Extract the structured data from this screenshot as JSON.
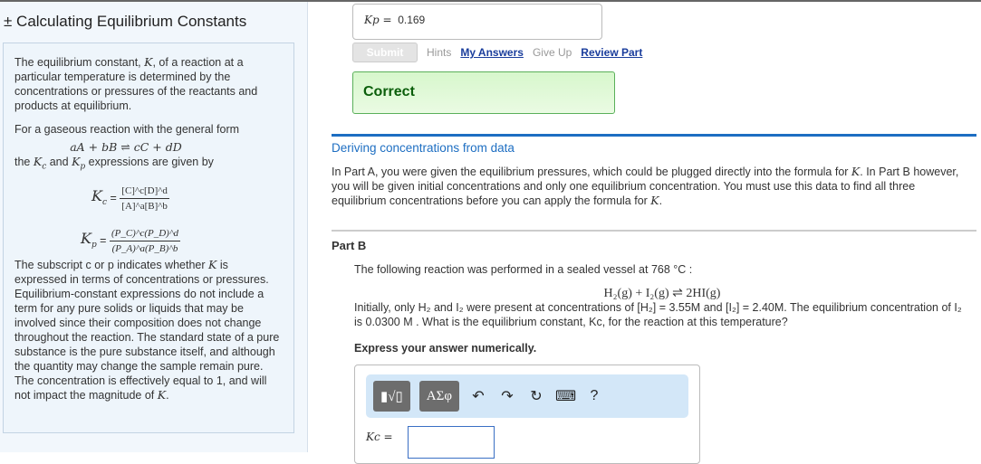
{
  "sidebar": {
    "title": "± Calculating Equilibrium Constants",
    "p1a": "The equilibrium constant, ",
    "K": "K",
    "p1b": ", of a reaction at a particular temperature is determined by the concentrations or pressures of the reactants and products at equilibrium.",
    "p2": "For a gaseous reaction with the general form",
    "general_reaction": "aA + bB ⇌ cC + dD",
    "p3a": "the ",
    "Kc": "Kc",
    "p3b": " and ",
    "Kp": "Kp",
    "p3c": " expressions are given by",
    "kc_num": "[C]^c[D]^d",
    "kc_den": "[A]^a[B]^b",
    "kp_num": "(P_C)^c(P_D)^d",
    "kp_den": "(P_A)^a(P_B)^b",
    "p4a": "The subscript c or p indicates whether ",
    "p4b": " is expressed in terms of concentrations or pressures. Equilibrium-constant expressions do not include a term for any pure solids or liquids that may be involved since their composition does not change throughout the reaction. The standard state of a pure substance is the pure substance itself, and although the quantity may change the sample remain pure. The concentration is effectively equal to 1, and will not impact the magnitude of ",
    "p4c": "."
  },
  "partA": {
    "answer_label": "Kp =",
    "answer_value": "0.169",
    "submit": "Submit",
    "hints": "Hints",
    "my_answers": "My Answers",
    "give_up": "Give Up",
    "review": "Review Part",
    "status": "Correct"
  },
  "section": {
    "heading": "Deriving concentrations from data",
    "intro_a": "In Part A, you were given the equilibrium pressures, which could be plugged directly into the formula for ",
    "intro_b": ". In Part B however, you will be given initial concentrations and only one equilibrium concentration. You must use this data to find all three equilibrium concentrations before you can apply the formula for ",
    "intro_c": "."
  },
  "partB": {
    "title": "Part B",
    "q1": "The following reaction was performed in a sealed vessel at 768 °C :",
    "reaction": "H₂(g) + I₂(g) ⇌ 2HI(g)",
    "q2": "Initially, only H₂ and I₂ were present at concentrations of [H₂] = 3.55M and [I₂] = 2.40M. The equilibrium concentration of I₂ is 0.0300 M . What is the equilibrium constant, Kc, for the reaction at this temperature?",
    "express": "Express your answer numerically.",
    "answer_label": "Kc =",
    "answer_value": "",
    "toolbar": {
      "templates": "▮√▯",
      "greek": "ΑΣφ",
      "help": "?"
    }
  }
}
